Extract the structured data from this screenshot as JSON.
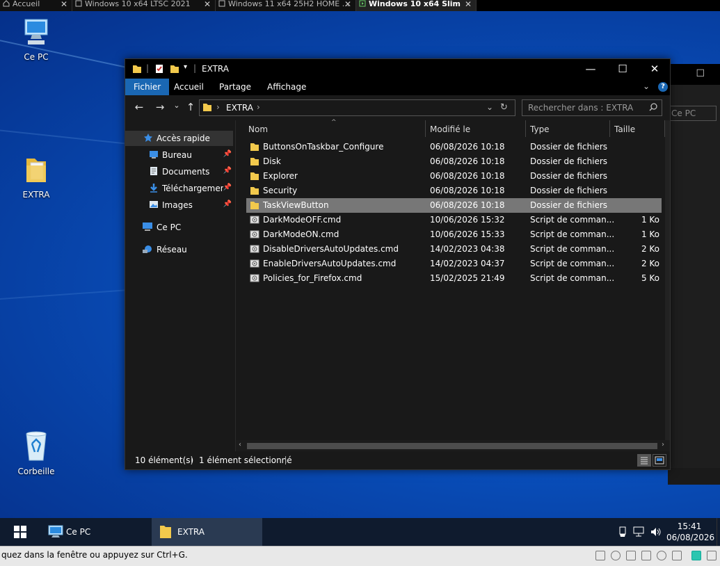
{
  "vm_tabs": [
    {
      "label": "Accueil",
      "icon": "home-icon"
    },
    {
      "label": "Windows 10 x64 LTSC 2021",
      "icon": "vm-icon"
    },
    {
      "label": "Windows 11 x64 25H2 HOME ...",
      "icon": "vm-icon"
    },
    {
      "label": "Windows 10 x64 Slim",
      "icon": "vm-running-icon",
      "active": true
    }
  ],
  "desktop_icons": [
    {
      "label": "Ce PC",
      "icon": "computer-icon"
    },
    {
      "label": "EXTRA",
      "icon": "folder-icon"
    },
    {
      "label": "Corbeille",
      "icon": "recycle-bin-icon"
    }
  ],
  "ghost_window": {
    "search_text": "Ce PC",
    "close_glyph": "☐"
  },
  "explorer": {
    "title": "EXTRA",
    "ribbon_tabs": [
      {
        "label": "Fichier",
        "active": true
      },
      {
        "label": "Accueil"
      },
      {
        "label": "Partage"
      },
      {
        "label": "Affichage"
      }
    ],
    "help_glyph": "?",
    "window_buttons": {
      "minimize": "—",
      "maximize": "☐",
      "close": "✕"
    },
    "nav_glyphs": {
      "back": "←",
      "forward": "→",
      "recent": "⌄",
      "up": "↑",
      "dropdown": "⌄",
      "refresh": "↻"
    },
    "address": {
      "crumb": "EXTRA",
      "sep": "›"
    },
    "search": {
      "placeholder": "Rechercher dans : EXTRA"
    },
    "nav_pane": [
      {
        "label": "Accès rapide",
        "icon": "star-icon",
        "selected": true
      },
      {
        "label": "Bureau",
        "icon": "desktop-icon",
        "pinned": true
      },
      {
        "label": "Documents",
        "icon": "documents-icon",
        "pinned": true
      },
      {
        "label": "Téléchargements",
        "icon": "downloads-icon",
        "pinned": true
      },
      {
        "label": "Images",
        "icon": "images-icon",
        "pinned": true
      },
      {
        "label": "Ce PC",
        "icon": "computer-icon"
      },
      {
        "label": "Réseau",
        "icon": "network-icon"
      }
    ],
    "columns": {
      "name": "Nom",
      "modified": "Modifié le",
      "type": "Type",
      "size": "Taille"
    },
    "files": [
      {
        "name": "ButtonsOnTaskbar_Configure",
        "modified": "06/08/2026 10:18",
        "type": "Dossier de fichiers",
        "size": "",
        "kind": "folder"
      },
      {
        "name": "Disk",
        "modified": "06/08/2026 10:18",
        "type": "Dossier de fichiers",
        "size": "",
        "kind": "folder"
      },
      {
        "name": "Explorer",
        "modified": "06/08/2026 10:18",
        "type": "Dossier de fichiers",
        "size": "",
        "kind": "folder"
      },
      {
        "name": "Security",
        "modified": "06/08/2026 10:18",
        "type": "Dossier de fichiers",
        "size": "",
        "kind": "folder"
      },
      {
        "name": "TaskViewButton",
        "modified": "06/08/2026 10:18",
        "type": "Dossier de fichiers",
        "size": "",
        "kind": "folder",
        "selected": true
      },
      {
        "name": "DarkModeOFF.cmd",
        "modified": "10/06/2026 15:32",
        "type": "Script de comman...",
        "size": "1 Ko",
        "kind": "cmd"
      },
      {
        "name": "DarkModeON.cmd",
        "modified": "10/06/2026 15:33",
        "type": "Script de comman...",
        "size": "1 Ko",
        "kind": "cmd"
      },
      {
        "name": "DisableDriversAutoUpdates.cmd",
        "modified": "14/02/2023 04:38",
        "type": "Script de comman...",
        "size": "2 Ko",
        "kind": "cmd"
      },
      {
        "name": "EnableDriversAutoUpdates.cmd",
        "modified": "14/02/2023 04:37",
        "type": "Script de comman...",
        "size": "2 Ko",
        "kind": "cmd"
      },
      {
        "name": "Policies_for_Firefox.cmd",
        "modified": "15/02/2025 21:49",
        "type": "Script de comman...",
        "size": "5 Ko",
        "kind": "cmd"
      }
    ],
    "status": {
      "count": "10 élément(s)",
      "selection": "1 élément sélectionné"
    }
  },
  "taskbar": {
    "items": [
      {
        "label": "Ce PC",
        "icon": "computer-icon"
      },
      {
        "label": "EXTRA",
        "icon": "folder-icon",
        "active": true
      }
    ],
    "clock": {
      "time": "15:41",
      "date": "06/08/2026"
    },
    "tray_icons": [
      "usb-icon",
      "network-icon",
      "speaker-icon"
    ]
  },
  "vm_status": {
    "hint": "quez dans la fenêtre ou appuyez sur Ctrl+G."
  },
  "colors": {
    "accent": "#1a67b3",
    "selection": "#777777",
    "folder": "#f2c94c"
  }
}
